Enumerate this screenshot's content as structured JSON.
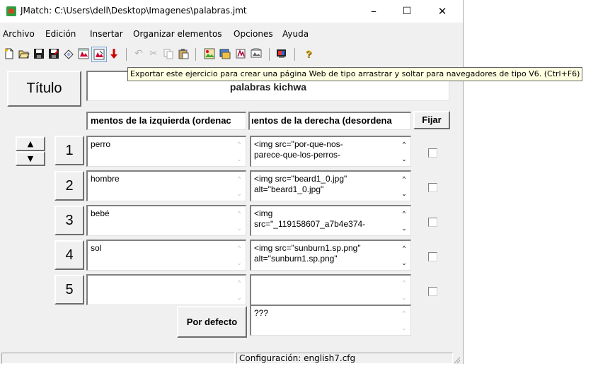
{
  "window": {
    "title": "JMatch: C:\\Users\\dell\\Desktop\\Imagenes\\palabras.jmt",
    "minimize_glyph": "–",
    "maximize_glyph": "☐",
    "close_glyph": "✕"
  },
  "menu": [
    "Archivo",
    "Edición",
    "Insertar",
    "Organizar elementos",
    "Opciones",
    "Ayuda"
  ],
  "toolbar": {
    "icons": [
      "new-file-icon",
      "open-folder-icon",
      "save-icon",
      "save-as-icon",
      "clear-icon",
      "export-web-icon",
      "export-dragdrop-icon",
      "import-icon",
      "undo-icon",
      "cut-icon",
      "copy-icon",
      "paste-icon",
      "insert-image-icon",
      "insert-table-icon",
      "insert-link-icon",
      "insert-media-icon",
      "translate-icon",
      "help-icon"
    ],
    "accent_color": "#d4a000"
  },
  "tooltip": "Exportar este ejercicio para crear una página Web de tipo arrastrar y soltar para navegadores de tipo V6. (Ctrl+F6)",
  "form": {
    "title_label": "Título",
    "title_value": "palabras kichwa",
    "left_header": "mentos de la izquierda (ordenac",
    "right_header": "ıentos de la derecha (desordena",
    "fix_header": "Fijar",
    "move_up_glyph": "▲",
    "move_down_glyph": "▼",
    "rows": [
      {
        "num": "1",
        "left": "perro",
        "right": "<img src=\"por-que-nos-\nparece-que-los-perros-"
      },
      {
        "num": "2",
        "left": "hombre",
        "right": "<img src=\"beard1_0.jpg\"\nalt=\"beard1_0.jpg\""
      },
      {
        "num": "3",
        "left": "bebé",
        "right": "<img\nsrc=\"_119158607_a7b4e374-"
      },
      {
        "num": "4",
        "left": "sol",
        "right": "<img src=\"sunburn1.sp.png\"\nalt=\"sunburn1.sp.png\""
      },
      {
        "num": "5",
        "left": "",
        "right": ""
      }
    ],
    "default_button": "Por defecto",
    "default_value": "???"
  },
  "status": {
    "left": "",
    "config": "Configuración: english7.cfg"
  }
}
